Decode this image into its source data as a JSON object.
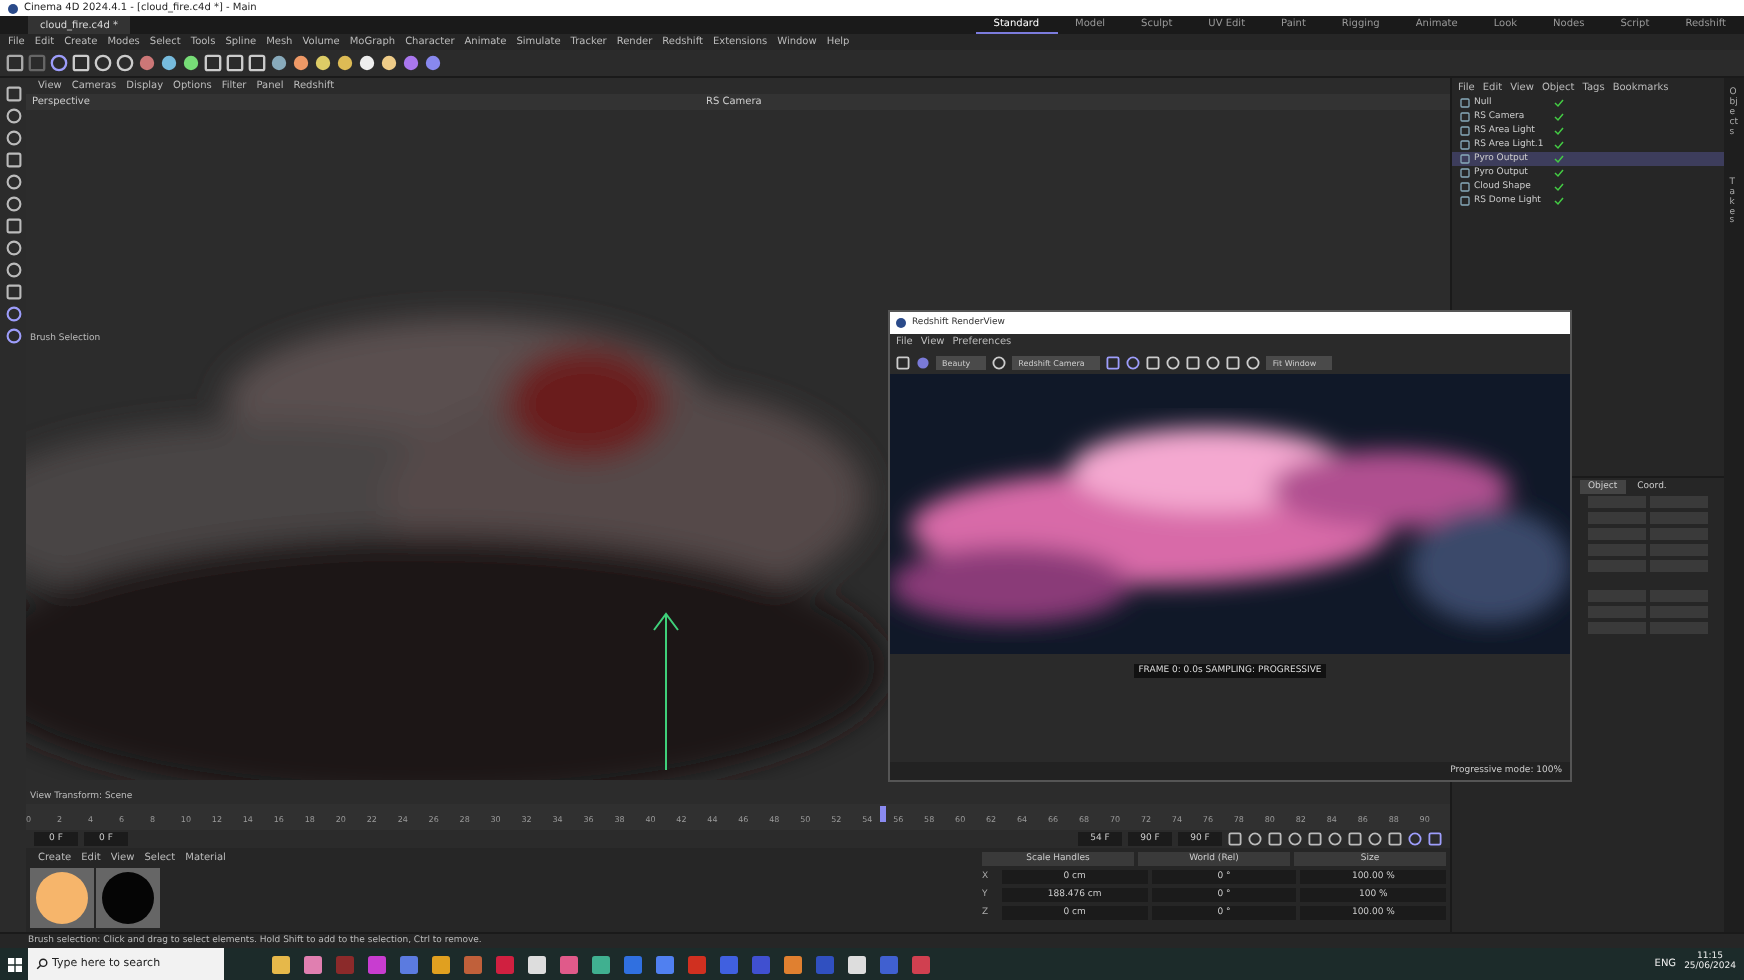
{
  "window": {
    "title": "Cinema 4D 2024.4.1 - [cloud_fire.c4d *] - Main"
  },
  "doc_tabs": [
    {
      "label": "cloud_fire.c4d *",
      "selected": true
    }
  ],
  "layouts": [
    {
      "label": "Standard",
      "selected": true
    },
    {
      "label": "Model",
      "selected": false
    },
    {
      "label": "Sculpt",
      "selected": false
    },
    {
      "label": "UV Edit",
      "selected": false
    },
    {
      "label": "Paint",
      "selected": false
    },
    {
      "label": "Rigging",
      "selected": false
    },
    {
      "label": "Animate",
      "selected": false
    },
    {
      "label": "Look",
      "selected": false
    },
    {
      "label": "Nodes",
      "selected": false
    },
    {
      "label": "Script",
      "selected": false
    },
    {
      "label": "Redshift",
      "selected": false
    }
  ],
  "menu": [
    "File",
    "Edit",
    "Create",
    "Modes",
    "Select",
    "Tools",
    "Spline",
    "Mesh",
    "Volume",
    "MoGraph",
    "Character",
    "Animate",
    "Simulate",
    "Tracker",
    "Render",
    "Redshift",
    "Extensions",
    "Window",
    "Help"
  ],
  "viewport": {
    "menu": [
      "View",
      "Cameras",
      "Display",
      "Options",
      "Filter",
      "Panel",
      "Redshift"
    ],
    "name": "Perspective",
    "camera": "RS Camera",
    "hud": "Brush Selection",
    "footer": "View Transform: Scene"
  },
  "renderview": {
    "title": "Redshift RenderView",
    "menu": [
      "File",
      "View",
      "Preferences"
    ],
    "aov": "Beauty",
    "camera": "Redshift Camera",
    "zoom": "Fit Window",
    "status": "FRAME 0: 0.0s  SAMPLING: PROGRESSIVE",
    "progress": "Progressive mode: 100%"
  },
  "object_menu": [
    "File",
    "Edit",
    "View",
    "Object",
    "Tags",
    "Bookmarks"
  ],
  "objects": [
    {
      "name": "Null",
      "selected": false
    },
    {
      "name": "RS Camera",
      "selected": false
    },
    {
      "name": "RS Area Light",
      "selected": false
    },
    {
      "name": "RS Area Light.1",
      "selected": false
    },
    {
      "name": "Pyro Output",
      "selected": true
    },
    {
      "name": "Pyro Output",
      "selected": false
    },
    {
      "name": "Cloud Shape",
      "selected": false
    },
    {
      "name": "RS Dome Light",
      "selected": false
    }
  ],
  "side_tabs": [
    "Objects",
    "Takes"
  ],
  "attribute_tabs": [
    {
      "label": "Object",
      "selected": true
    },
    {
      "label": "Coord.",
      "selected": false
    }
  ],
  "timeline": {
    "ticks": [
      "0",
      "2",
      "4",
      "6",
      "8",
      "10",
      "12",
      "14",
      "16",
      "18",
      "20",
      "22",
      "24",
      "26",
      "28",
      "30",
      "32",
      "34",
      "36",
      "38",
      "40",
      "42",
      "44",
      "46",
      "48",
      "50",
      "52",
      "54",
      "56",
      "58",
      "60",
      "62",
      "64",
      "66",
      "68",
      "70",
      "72",
      "74",
      "76",
      "78",
      "80",
      "82",
      "84",
      "86",
      "88",
      "90"
    ],
    "level": 0.6,
    "start": "0 F",
    "start_min": "0 F",
    "end": "90 F",
    "end_max": "90 F",
    "frame": "54 F"
  },
  "material_menu": [
    "Create",
    "Edit",
    "View",
    "Select",
    "Material"
  ],
  "materials": [
    {
      "color": "#f6b56b"
    },
    {
      "color": "#050505"
    }
  ],
  "coordinates": {
    "modes": [
      "Scale Handles",
      "World (Rel)",
      "Size"
    ],
    "rows": [
      {
        "axis": "X",
        "values": [
          "0 cm",
          "0 °",
          "100.00 %"
        ]
      },
      {
        "axis": "Y",
        "values": [
          "188.476 cm",
          "0 °",
          "100 %"
        ]
      },
      {
        "axis": "Z",
        "values": [
          "0 cm",
          "0 °",
          "100.00 %"
        ]
      }
    ]
  },
  "status_bar": "Brush selection: Click and drag to select elements. Hold Shift to add to the selection, Ctrl to remove.",
  "taskbar": {
    "search": {
      "placeholder": "Type here to search"
    },
    "language": "ENG",
    "time": "11:15",
    "date": "25/06/2024"
  }
}
